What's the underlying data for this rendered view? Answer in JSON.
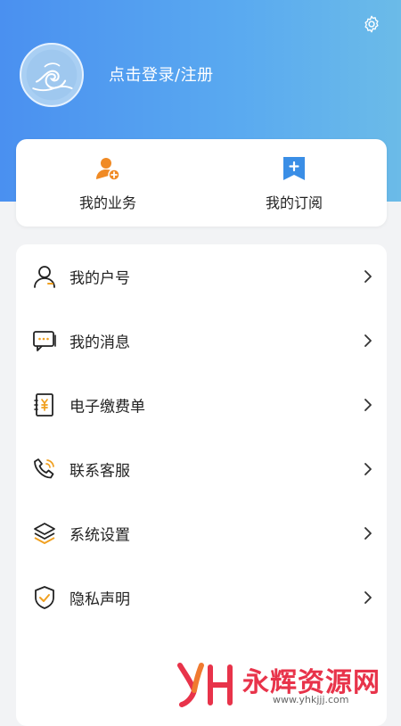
{
  "header": {
    "login_text": "点击登录/注册",
    "settings_icon": "gear-icon",
    "avatar_icon": "wave-avatar"
  },
  "quick_actions": [
    {
      "label": "我的业务",
      "icon": "user-add-icon",
      "color": "#f08a24"
    },
    {
      "label": "我的订阅",
      "icon": "bookmark-plus-icon",
      "color": "#3a8ee6"
    }
  ],
  "menu": [
    {
      "label": "我的户号",
      "icon": "user-icon"
    },
    {
      "label": "我的消息",
      "icon": "message-icon"
    },
    {
      "label": "电子缴费单",
      "icon": "bill-icon"
    },
    {
      "label": "联系客服",
      "icon": "phone-icon"
    },
    {
      "label": "系统设置",
      "icon": "layers-icon"
    },
    {
      "label": "隐私声明",
      "icon": "shield-check-icon"
    }
  ],
  "watermark": {
    "text": "永辉资源网",
    "url": "www.yhkjjj.com"
  },
  "colors": {
    "header_start": "#4a90f0",
    "header_end": "#6bbbe8",
    "accent_orange": "#f0a020",
    "watermark_red": "#e8334a"
  }
}
